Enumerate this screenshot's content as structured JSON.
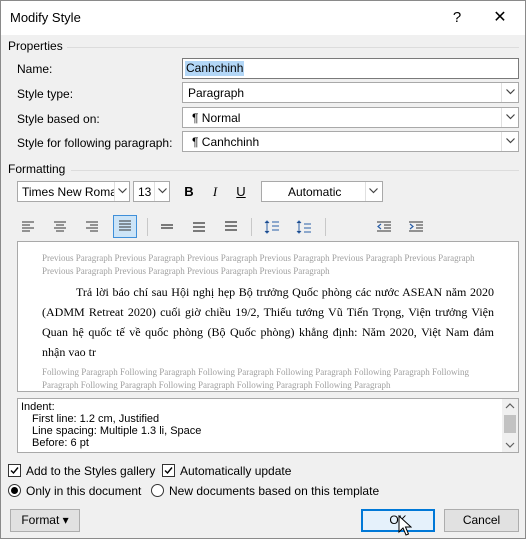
{
  "window": {
    "title": "Modify Style",
    "help": "?",
    "close": "✕"
  },
  "properties": {
    "heading": "Properties",
    "name_label": "Name:",
    "name_value": "Canhchinh",
    "style_type_label": "Style type:",
    "style_type_value": "Paragraph",
    "style_based_on_label": "Style based on:",
    "style_based_on_value": "¶  Normal",
    "style_following_label": "Style for following paragraph:",
    "style_following_value": "¶  Canhchinh"
  },
  "formatting": {
    "heading": "Formatting",
    "font_name": "Times New Roman",
    "font_size": "13",
    "bold": "B",
    "italic": "I",
    "underline": "U",
    "color": "Automatic"
  },
  "preview": {
    "previous": "Previous Paragraph Previous Paragraph Previous Paragraph Previous Paragraph Previous Paragraph Previous Paragraph Previous Paragraph Previous Paragraph Previous Paragraph Previous Paragraph",
    "main": "Trả lời báo chí sau Hội nghị hẹp Bộ trưởng Quốc phòng các nước ASEAN năm 2020 (ADMM Retreat 2020) cuối giờ chiều 19/2, Thiếu tướng Vũ Tiến Trọng, Viện trưởng Viện Quan hệ quốc tế về quốc phòng (Bộ Quốc phòng) khẳng định: Năm 2020, Việt Nam đảm nhận vao tr",
    "following": "Following Paragraph Following Paragraph Following Paragraph Following Paragraph Following Paragraph Following Paragraph Following Paragraph Following Paragraph Following Paragraph Following Paragraph"
  },
  "description": {
    "line1": "Indent:",
    "line2": "First line:  1.2 cm, Justified",
    "line3": "Line spacing:  Multiple 1.3 li, Space",
    "line4": "Before:  6 pt"
  },
  "options": {
    "add_to_gallery": "Add to the Styles gallery",
    "auto_update": "Automatically update",
    "only_this_doc": "Only in this document",
    "new_docs": "New documents based on this template"
  },
  "buttons": {
    "format": "Format ▾",
    "ok": "OK",
    "cancel": "Cancel"
  },
  "colors": {
    "accent": "#0078d7",
    "selection": "#b3d7f7",
    "active_toggle": "#cce4f7"
  }
}
